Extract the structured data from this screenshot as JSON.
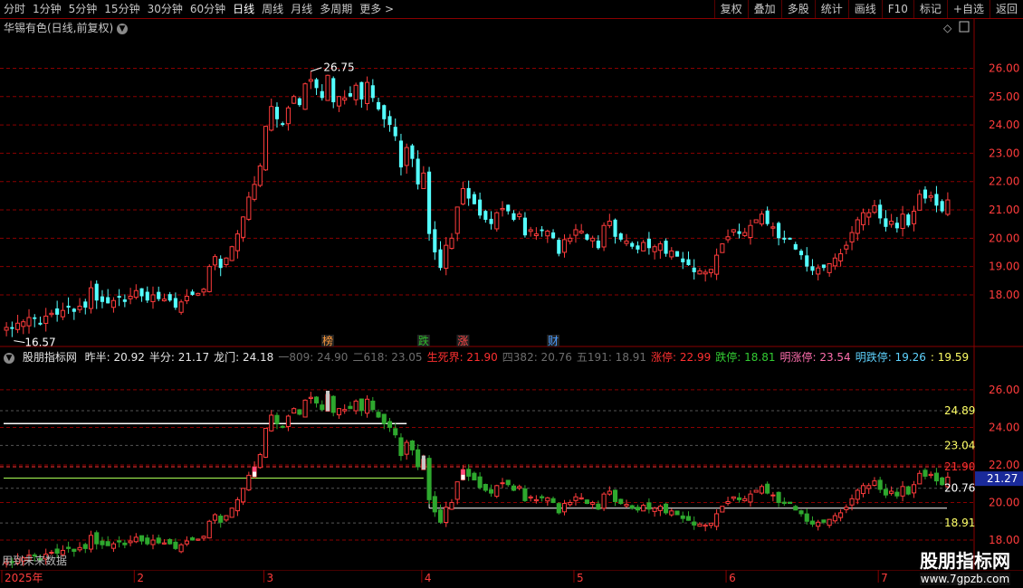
{
  "topbar": {
    "periods": [
      "分时",
      "1分钟",
      "5分钟",
      "15分钟",
      "30分钟",
      "60分钟",
      "日线",
      "周线",
      "月线",
      "多周期",
      "更多 >"
    ],
    "active_period": "日线",
    "tools": [
      "复权",
      "叠加",
      "多股",
      "统计",
      "画线",
      "F10",
      "标记",
      "+自选",
      "返回"
    ]
  },
  "stock": {
    "title": "华锡有色(日线,前复权)"
  },
  "main_chart": {
    "high_label": "26.75",
    "low_label": "16.57",
    "markers": [
      {
        "text": "榜",
        "color": "#ff9a3c",
        "index": 57
      },
      {
        "text": "跌",
        "color": "#2dbb2d",
        "index": 74
      },
      {
        "text": "涨",
        "color": "#ff4444",
        "index": 81
      },
      {
        "text": "财",
        "color": "#4a9cff",
        "index": 97
      }
    ]
  },
  "indicator": {
    "name": "股朋指标网",
    "items": [
      {
        "label": "昨半: 20.92",
        "color": "#e6e6e6"
      },
      {
        "label": "半分: 21.17",
        "color": "#e6e6e6"
      },
      {
        "label": "龙门: 24.18",
        "color": "#e6e6e6"
      },
      {
        "label": "一809: 24.90",
        "color": "#6e6e6e"
      },
      {
        "label": "二618: 23.05",
        "color": "#6e6e6e"
      },
      {
        "label": "生死界: 21.90",
        "color": "#ff3030"
      },
      {
        "label": "四382: 20.76",
        "color": "#6e6e6e"
      },
      {
        "label": "五191: 18.91",
        "color": "#6e6e6e"
      },
      {
        "label": "涨停: 22.99",
        "color": "#ff3030"
      },
      {
        "label": "跌停: 18.81",
        "color": "#33cc33"
      },
      {
        "label": "明涨停: 23.54",
        "color": "#ff6fae"
      },
      {
        "label": "明跌停: 19.26",
        "color": "#5fd3ff"
      },
      {
        "label": ": 19.59",
        "color": "#ffff66"
      }
    ],
    "level_labels": [
      {
        "text": "24.89",
        "value": 24.89,
        "color": "#ffff66"
      },
      {
        "text": "23.04",
        "value": 23.04,
        "color": "#ffff66"
      },
      {
        "text": "20.76",
        "value": 20.76,
        "color": "#ffffff"
      },
      {
        "text": "18.91",
        "value": 18.91,
        "color": "#ffff66"
      }
    ],
    "current_price": "21.27",
    "current_price_value": 21.27,
    "red_line_text": "21.90",
    "red_line_value": 21.9,
    "footer_text": "用到未来数据"
  },
  "x_axis": {
    "labels": [
      "2025年",
      "2",
      "3",
      "4",
      "5",
      "6",
      "7"
    ]
  },
  "watermark": {
    "title": "股朋指标网",
    "url": "www.7gpzb.com"
  },
  "colors": {
    "up": "#ff3c3c",
    "down": "#54ffff",
    "ind_up": "#ff3c3c",
    "ind_down": "#2ea82e",
    "grid": "#8a0000"
  },
  "chart_data": {
    "type": "candlestick",
    "y_ticks": [
      18.0,
      19.0,
      20.0,
      21.0,
      22.0,
      23.0,
      24.0,
      25.0,
      26.0
    ],
    "ylim": [
      17.2,
      27.1
    ],
    "indicator_y_ticks": [
      18.0,
      20.0,
      22.0,
      24.0,
      26.0
    ],
    "indicator_ylim": [
      16.7,
      27.2
    ],
    "closes": [
      16.85,
      16.8,
      17.0,
      17.05,
      17.2,
      17.15,
      16.95,
      17.25,
      17.35,
      17.3,
      17.45,
      17.55,
      17.4,
      17.6,
      17.55,
      18.25,
      17.8,
      17.75,
      17.7,
      17.8,
      17.9,
      17.75,
      17.95,
      18.15,
      17.95,
      17.8,
      18.0,
      17.85,
      17.85,
      17.8,
      17.55,
      17.75,
      17.95,
      18.0,
      18.05,
      18.2,
      19.0,
      19.35,
      18.95,
      19.3,
      19.7,
      20.15,
      20.75,
      21.45,
      21.9,
      22.55,
      23.95,
      24.65,
      24.2,
      24.0,
      24.6,
      25.0,
      24.7,
      25.45,
      25.6,
      25.3,
      24.95,
      25.75,
      24.8,
      25.0,
      24.95,
      25.0,
      25.4,
      24.9,
      25.5,
      24.95,
      24.55,
      24.2,
      24.0,
      23.6,
      22.5,
      23.2,
      22.8,
      21.9,
      22.3,
      20.15,
      19.5,
      18.95,
      19.75,
      20.0,
      21.1,
      21.75,
      21.4,
      21.2,
      20.8,
      20.65,
      20.5,
      20.9,
      21.05,
      20.95,
      20.65,
      20.85,
      20.1,
      20.3,
      20.15,
      20.25,
      20.25,
      20.0,
      19.45,
      19.95,
      20.0,
      20.3,
      20.25,
      19.95,
      20.0,
      19.65,
      20.45,
      20.6,
      20.05,
      19.95,
      19.9,
      19.7,
      19.6,
      19.85,
      19.65,
      19.7,
      19.8,
      19.45,
      19.55,
      19.35,
      19.15,
      19.05,
      18.8,
      18.85,
      18.8,
      18.9,
      19.4,
      19.8,
      20.05,
      20.3,
      20.15,
      20.2,
      20.45,
      20.65,
      20.85,
      20.5,
      20.4,
      20.0,
      19.95,
      19.95,
      19.6,
      19.4,
      19.0,
      18.85,
      18.95,
      18.95,
      19.1,
      19.3,
      19.45,
      19.75,
      20.2,
      20.65,
      20.9,
      20.9,
      21.15,
      20.7,
      20.4,
      20.6,
      20.35,
      20.85,
      20.45,
      20.95,
      21.55,
      21.4,
      21.5,
      21.15,
      20.95,
      21.35
    ]
  }
}
